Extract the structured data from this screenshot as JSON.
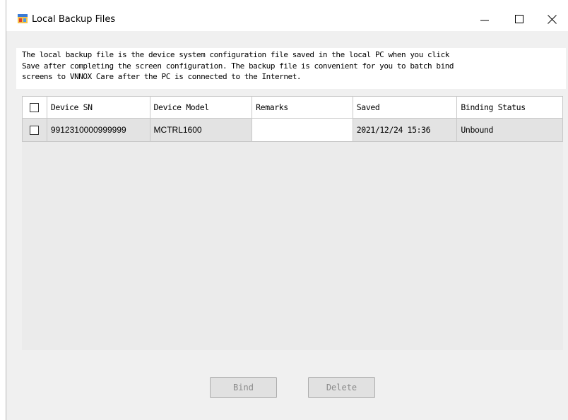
{
  "window": {
    "title": "Local Backup Files",
    "controls": {
      "minimize": "—",
      "maximize": "☐",
      "close": "✕"
    }
  },
  "description": "The local backup file is the device system configuration file saved in the local PC when you click\nSave after completing the screen configuration. The backup file is convenient for you to batch bind\nscreens to VNNOX Care after the PC is connected to the Internet.",
  "table": {
    "columns": [
      "Device SN",
      "Device Model",
      "Remarks",
      "Saved",
      "Binding Status"
    ],
    "rows": [
      {
        "checked": false,
        "device_sn": "9912310000999999",
        "device_model": "MCTRL1600",
        "remarks": "",
        "saved": "2021/12/24 15:36",
        "binding_status": "Unbound"
      }
    ]
  },
  "buttons": {
    "bind": "Bind",
    "delete": "Delete"
  }
}
